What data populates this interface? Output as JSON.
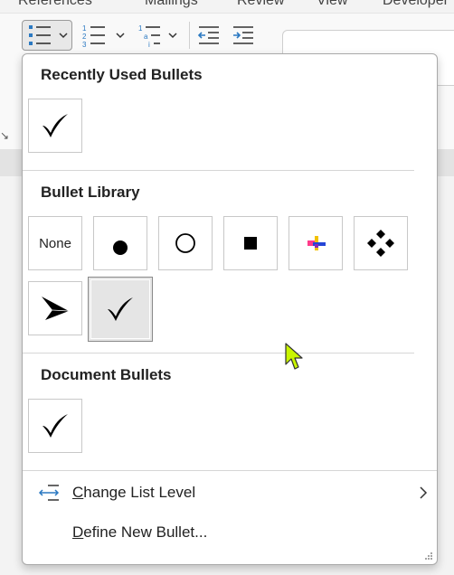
{
  "ribbon": {
    "tabs": [
      {
        "label": "References"
      },
      {
        "label": "Mailings"
      },
      {
        "label": "Review"
      },
      {
        "label": "View"
      },
      {
        "label": "Developer"
      }
    ]
  },
  "menu": {
    "recently_used": {
      "title": "Recently Used Bullets",
      "items": [
        {
          "symbol": "checkmark-icon"
        }
      ]
    },
    "library": {
      "title": "Bullet Library",
      "items": [
        {
          "label": "None"
        },
        {
          "symbol": "filled-circle-icon"
        },
        {
          "symbol": "hollow-circle-icon"
        },
        {
          "symbol": "filled-square-icon"
        },
        {
          "symbol": "colored-cross-icon"
        },
        {
          "symbol": "four-diamonds-icon"
        },
        {
          "symbol": "arrowhead-icon"
        },
        {
          "symbol": "checkmark-icon",
          "selected": true
        }
      ]
    },
    "document": {
      "title": "Document Bullets",
      "items": [
        {
          "symbol": "checkmark-icon"
        }
      ]
    },
    "change_level": {
      "label": "Change List Level",
      "accel": "C"
    },
    "define_new": {
      "label": "Define New Bullet...",
      "accel": "D"
    }
  },
  "colors": {
    "accent": "#2b79c2",
    "cursor": "#c9f500"
  }
}
